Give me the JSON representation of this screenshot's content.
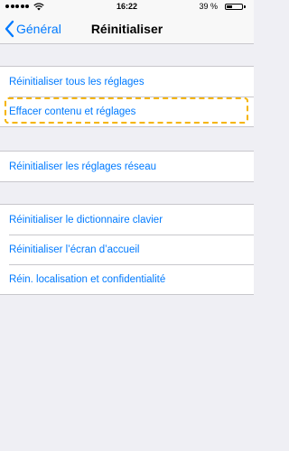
{
  "status_bar": {
    "time": "16:22",
    "battery_percent": "39 %",
    "battery_level": 0.39
  },
  "nav": {
    "back_label": "Général",
    "title": "Réinitialiser"
  },
  "groups": [
    [
      "Réinitialiser tous les réglages",
      "Effacer contenu et réglages"
    ],
    [
      "Réinitialiser les réglages réseau"
    ],
    [
      "Réinitialiser le dictionnaire clavier",
      "Réinitialiser l’écran d’accueil",
      "Réin. localisation et confidentialité"
    ]
  ],
  "colors": {
    "accent": "#007aff",
    "highlight": "#f5b400",
    "background": "#efeff4"
  }
}
